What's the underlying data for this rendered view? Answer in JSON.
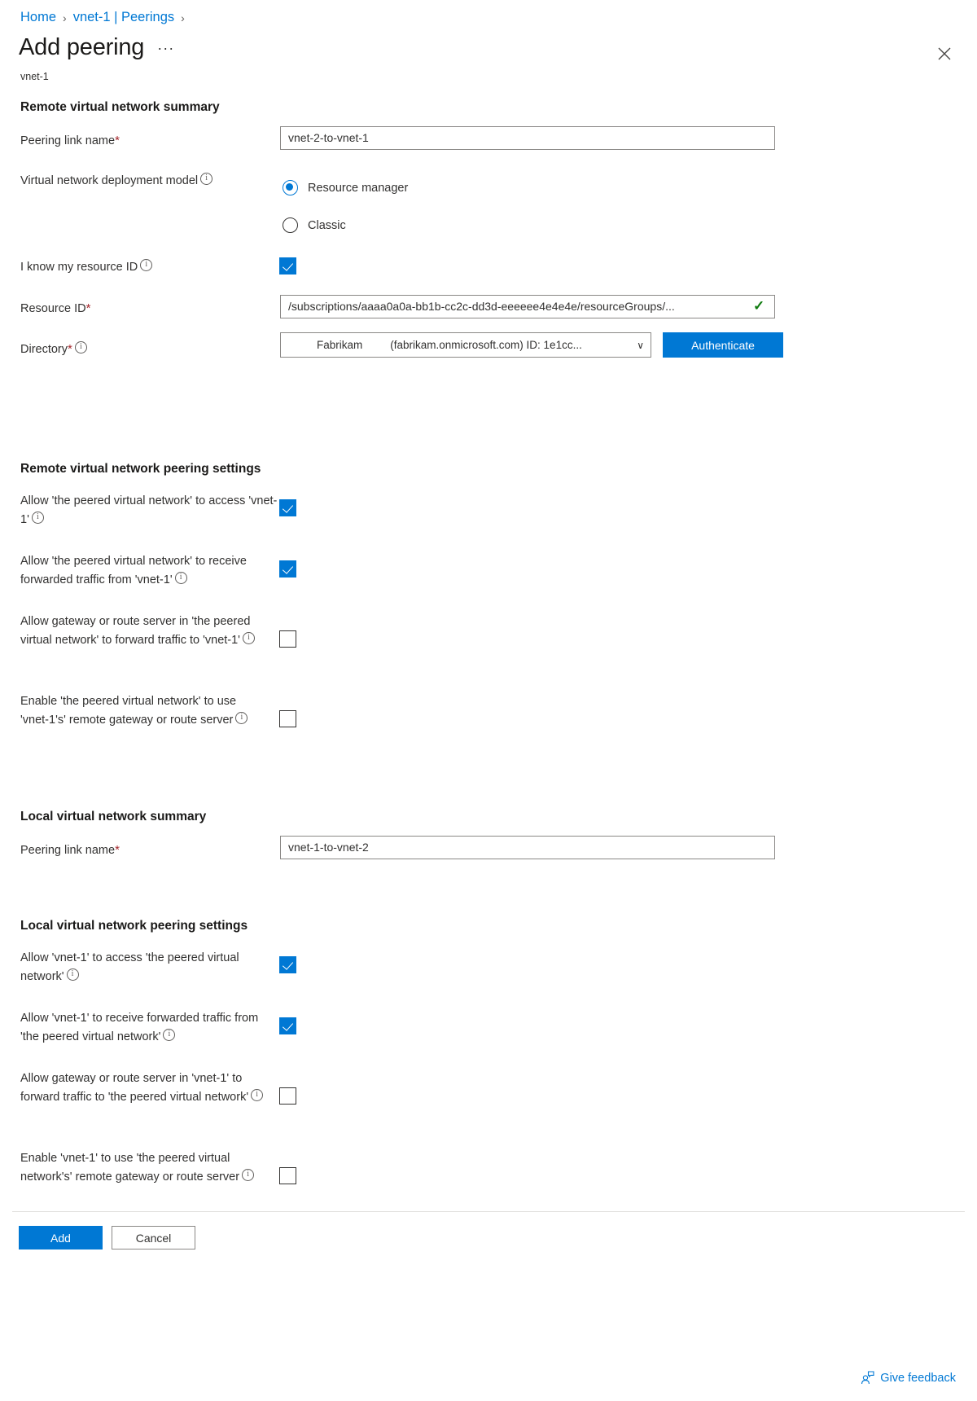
{
  "breadcrumb": {
    "items": [
      "Home",
      "vnet-1 | Peerings"
    ],
    "separator": "›"
  },
  "header": {
    "title": "Add peering",
    "ellipsis": "···",
    "subtitle": "vnet-1",
    "close_icon": "close-icon"
  },
  "remote_summary": {
    "heading": "Remote virtual network summary",
    "peering_link_name": {
      "label": "Peering link name",
      "required": "*",
      "value": "vnet-2-to-vnet-1"
    },
    "deployment_model": {
      "label": "Virtual network deployment model",
      "options": [
        "Resource manager",
        "Classic"
      ],
      "selected": "Resource manager"
    },
    "know_resource_id": {
      "label": "I know my resource ID",
      "checked": true
    },
    "resource_id": {
      "label": "Resource ID",
      "required": "*",
      "value": "/subscriptions/aaaa0a0a-bb1b-cc2c-dd3d-eeeeee4e4e4e/resourceGroups/...",
      "valid_mark": "✓"
    },
    "directory": {
      "label": "Directory",
      "required": "*",
      "name": "Fabrikam",
      "detail": "(fabrikam.onmicrosoft.com) ID: 1e1cc...",
      "chevron": "∨",
      "authenticate_label": "Authenticate"
    }
  },
  "remote_settings": {
    "heading": "Remote virtual network peering settings",
    "items": [
      {
        "label": "Allow 'the peered virtual network' to access 'vnet-1'",
        "checked": true
      },
      {
        "label": "Allow 'the peered virtual network' to receive forwarded traffic from 'vnet-1'",
        "checked": true
      },
      {
        "label": "Allow gateway or route server in 'the peered virtual network' to forward traffic to 'vnet-1'",
        "checked": false
      },
      {
        "label": "Enable 'the peered virtual network' to use 'vnet-1's' remote gateway or route server",
        "checked": false
      }
    ]
  },
  "local_summary": {
    "heading": "Local virtual network summary",
    "peering_link_name": {
      "label": "Peering link name",
      "required": "*",
      "value": "vnet-1-to-vnet-2"
    }
  },
  "local_settings": {
    "heading": "Local virtual network peering settings",
    "items": [
      {
        "label": "Allow 'vnet-1' to access 'the peered virtual network'",
        "checked": true
      },
      {
        "label": "Allow 'vnet-1' to receive forwarded traffic from 'the peered virtual network'",
        "checked": true
      },
      {
        "label": "Allow gateway or route server in 'vnet-1' to forward traffic to 'the peered virtual network'",
        "checked": false
      },
      {
        "label": "Enable 'vnet-1' to use 'the peered virtual network's' remote gateway or route server",
        "checked": false
      }
    ]
  },
  "footer": {
    "add_label": "Add",
    "cancel_label": "Cancel",
    "feedback_label": "Give feedback",
    "feedback_icon": "person-feedback-icon"
  },
  "colors": {
    "accent": "#0078d4",
    "required": "#a4262c",
    "valid": "#107c10",
    "text": "#323130"
  }
}
